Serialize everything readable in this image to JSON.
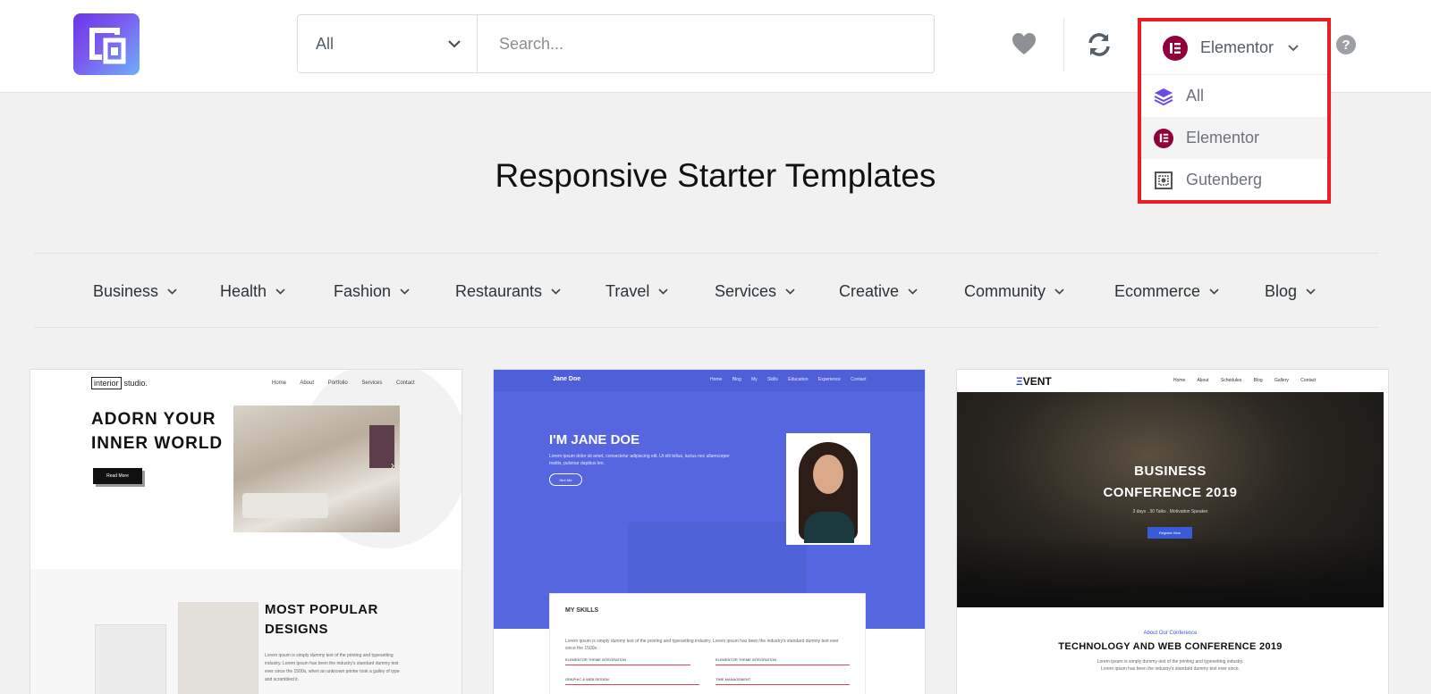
{
  "header": {
    "filter_value": "All",
    "search_placeholder": "Search...",
    "builder": {
      "current": "Elementor",
      "options": [
        "All",
        "Elementor",
        "Gutenberg"
      ]
    },
    "help_label": "?"
  },
  "page_title": "Responsive Starter Templates",
  "categories": [
    "Business",
    "Health",
    "Fashion",
    "Restaurants",
    "Travel",
    "Services",
    "Creative",
    "Community",
    "Ecommerce",
    "Blog"
  ],
  "cards": [
    {
      "logo_box": "interior",
      "logo_rest": "studio.",
      "nav": "Home About Portfolio Services Contact",
      "headline_1": "ADORN YOUR",
      "headline_2": "INNER WORLD",
      "button": "Read More",
      "h2_1": "MOST POPULAR",
      "h2_2": "DESIGNS",
      "para": "Lorem ipsum is simply dummy text of the printing and typesetting industry. Lorem ipsum has been the industry's standard dummy text ever since the 1500s, when an unknown printer took a galley of type and scrambled it."
    },
    {
      "brand": "Jane Doe",
      "nav": "Home Blog My Skills Education Experience Contact",
      "name": "I'M JANE DOE",
      "intro": "Lorem ipsum dolor sit amet, consectetur adipiscing elit. Ut elit tellus, luctus nec ullamcorper mattis, pulvinar dapibus leo.",
      "button": "Hire Me",
      "skills": "MY SKILLS",
      "para": "Lorem ipsum is simply dummy text of the printing and typesetting industry. Lorem ipsum has been the industry's standard dummy text ever since the 1500s.",
      "bars": [
        "ELEMENTOR THEME INTEGRATION",
        "ELEMENTOR THEME INTEGRATION",
        "GRAPHIC & WEB DESIGN",
        "TIME MANAGEMENT"
      ]
    },
    {
      "brand_e": "Ξ",
      "brand_rest": "VENT",
      "nav": "Home About Schedules Blog Gallery Contact",
      "title_1": "BUSINESS",
      "title_2": "CONFERENCE 2019",
      "sub": "3 days . 30 Talks . Motivation Speaker",
      "button": "Register Now",
      "about": "About Our Conference",
      "h2": "TECHNOLOGY AND WEB CONFERENCE 2019",
      "para": "Lorem ipsum is simply dummy text of the printing and typesetting industry. Lorem ipsum has been the industry's standard dummy text ever since."
    }
  ],
  "colors": {
    "brand_gradient_start": "#6a35e6",
    "brand_gradient_end": "#6fb1f7",
    "elementor": "#92003b",
    "highlight_border": "#ec1c24",
    "jane_blue": "#5566e0"
  }
}
